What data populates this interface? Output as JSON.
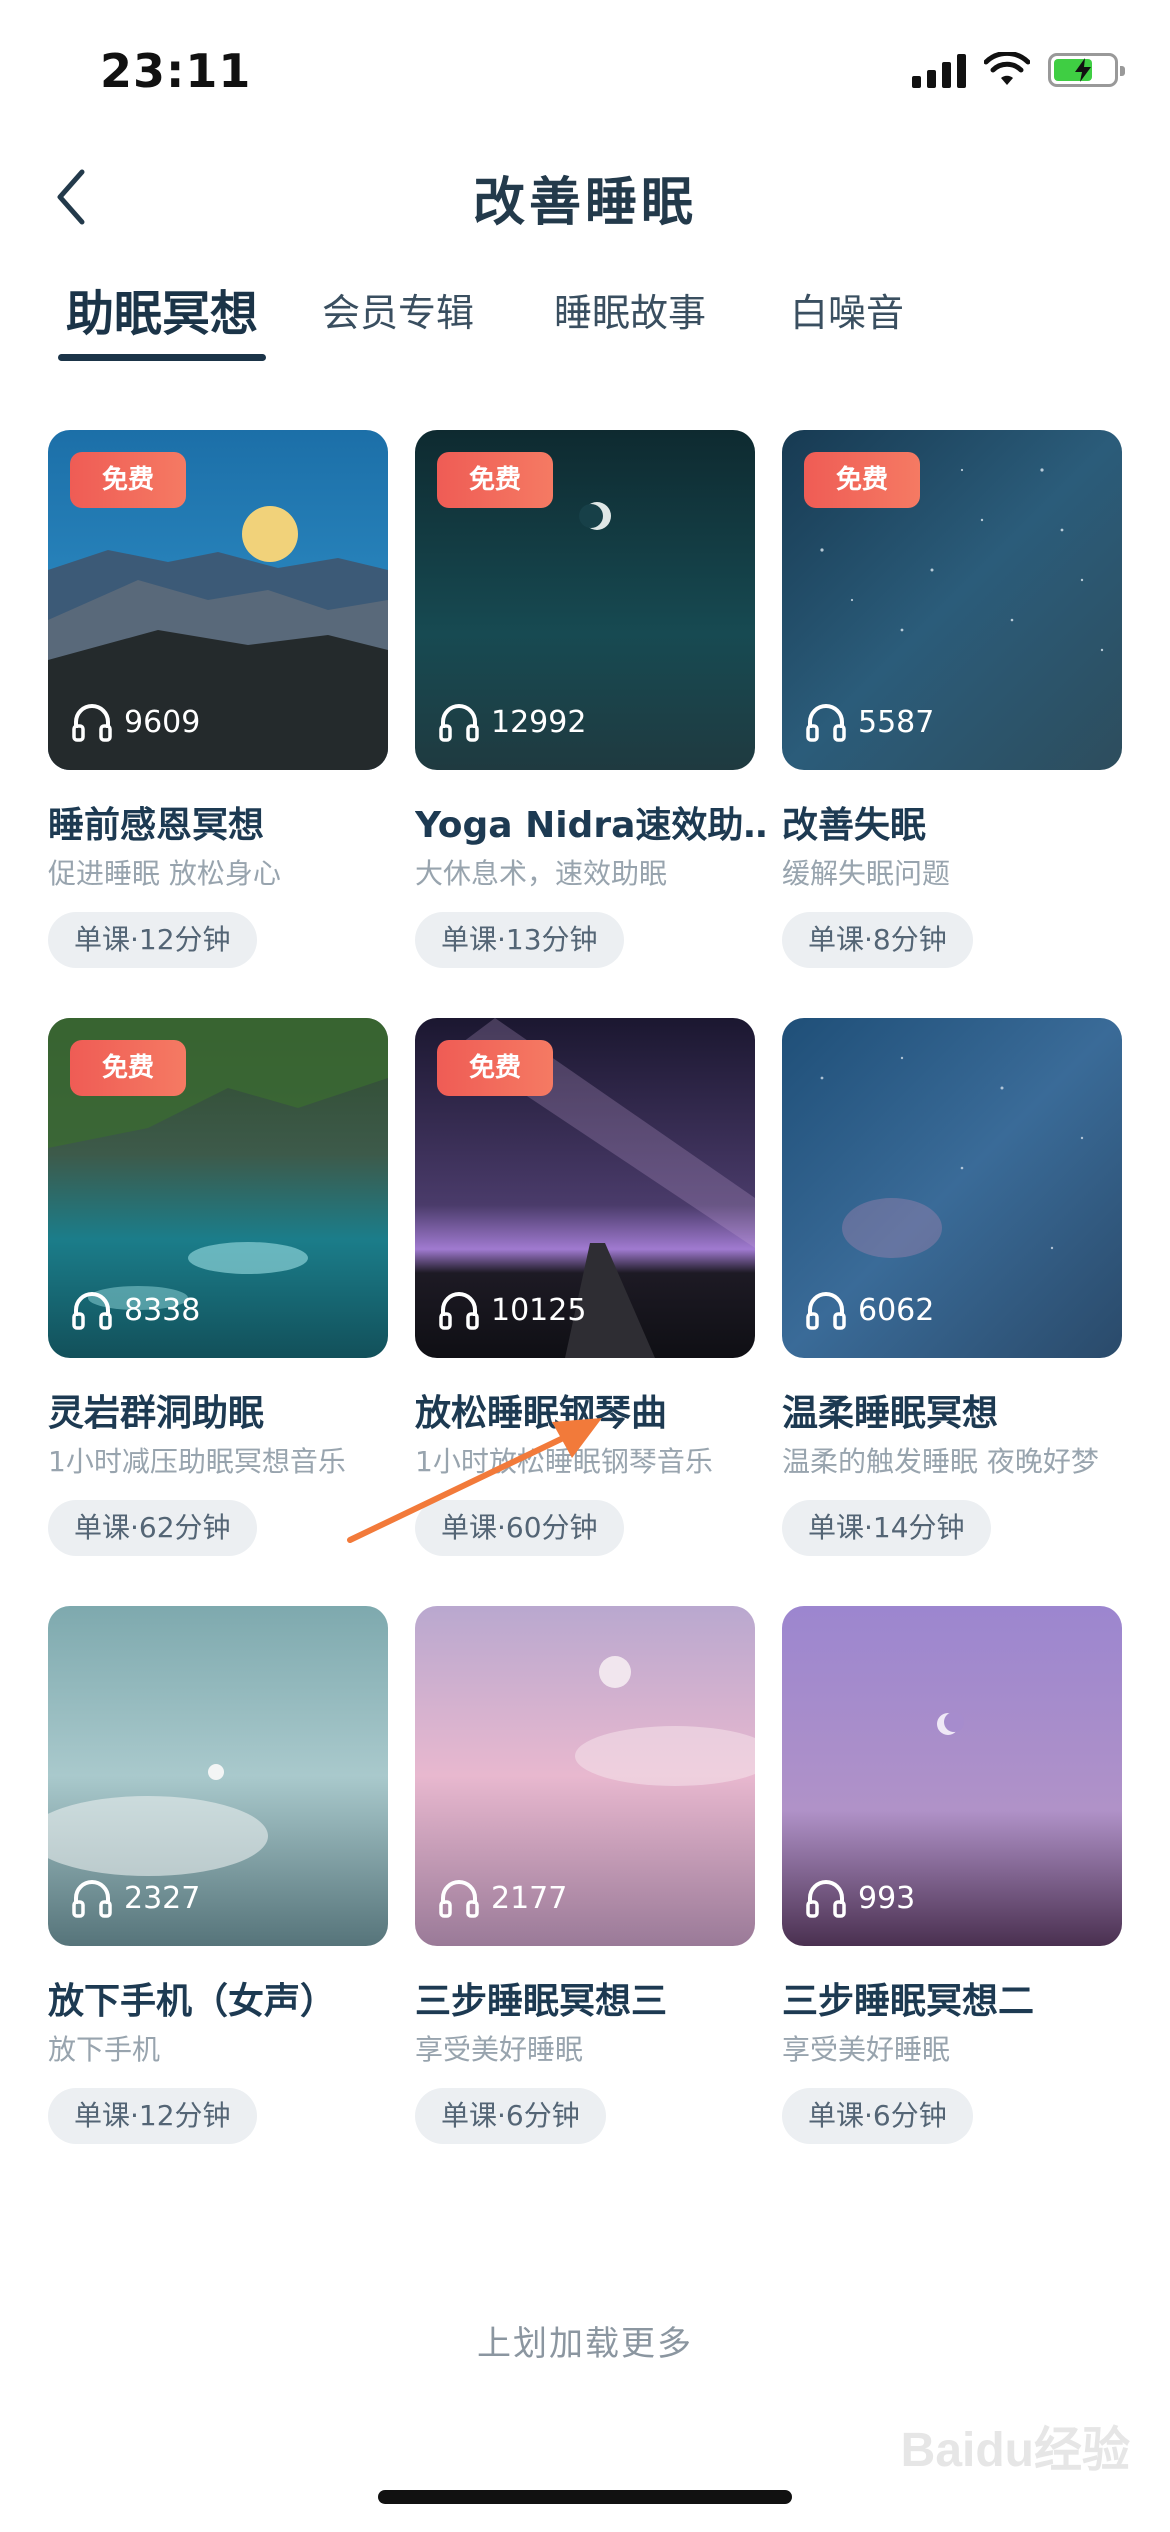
{
  "status": {
    "time": "23:11"
  },
  "nav": {
    "title": "改善睡眠"
  },
  "tabs": [
    {
      "label": "助眠冥想",
      "active": true
    },
    {
      "label": "会员专辑"
    },
    {
      "label": "睡眠故事"
    },
    {
      "label": "白噪音"
    }
  ],
  "cards": [
    {
      "badge": "免费",
      "plays": "9609",
      "title": "睡前感恩冥想",
      "subtitle": "促进睡眠 放松身心",
      "meta": "单课·12分钟"
    },
    {
      "badge": "免费",
      "plays": "12992",
      "title": "Yoga Nidra速效助…",
      "subtitle": "大休息术，速效助眠",
      "meta": "单课·13分钟"
    },
    {
      "badge": "免费",
      "plays": "5587",
      "title": "改善失眠",
      "subtitle": "缓解失眠问题",
      "meta": "单课·8分钟"
    },
    {
      "badge": "免费",
      "plays": "8338",
      "title": "灵岩群洞助眠",
      "subtitle": "1小时减压助眠冥想音乐",
      "meta": "单课·62分钟"
    },
    {
      "badge": "免费",
      "plays": "10125",
      "title": "放松睡眠钢琴曲",
      "subtitle": "1小时放松睡眠钢琴音乐",
      "meta": "单课·60分钟"
    },
    {
      "badge": "",
      "plays": "6062",
      "title": "温柔睡眠冥想",
      "subtitle": "温柔的触发睡眠 夜晚好梦",
      "meta": "单课·14分钟"
    },
    {
      "badge": "",
      "plays": "2327",
      "title": "放下手机（女声）",
      "subtitle": "放下手机",
      "meta": "单课·12分钟"
    },
    {
      "badge": "",
      "plays": "2177",
      "title": "三步睡眠冥想三",
      "subtitle": "享受美好睡眠",
      "meta": "单课·6分钟"
    },
    {
      "badge": "",
      "plays": "993",
      "title": "三步睡眠冥想二",
      "subtitle": "享受美好睡眠",
      "meta": "单课·6分钟"
    }
  ],
  "footer": {
    "load_more": "上划加载更多",
    "watermark": "Baidu经验"
  },
  "colors": {
    "badge": "#ef5c55",
    "arrow": "#f27a3a",
    "title": "#1d3a52"
  }
}
